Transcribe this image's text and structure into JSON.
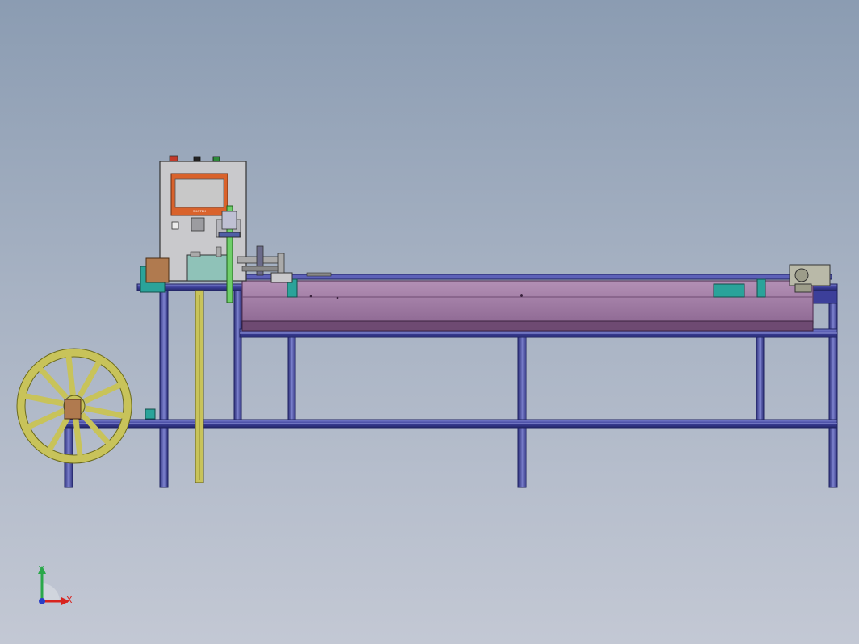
{
  "view": {
    "background_top": "#8b9cb2",
    "background_bottom": "#c3c8d4"
  },
  "machine": {
    "frame_color": "#3c3f9a",
    "frame_highlight": "#7d82cf",
    "bed_color": "#9e7aa4",
    "bed_edge": "#5b3a5e",
    "reel_color": "#c8c35a",
    "reel_edge": "#6b6a1c",
    "cabinet_color": "#c9c9cc",
    "screen_bezel": "#d9622b",
    "screen_color": "#c8c8c8",
    "bracket_color": "#2aa39a",
    "brown_block": "#b07a4f"
  },
  "control_panel": {
    "brand_label": "SKOTEK"
  },
  "triad": {
    "x_label": "X",
    "y_label": "Y",
    "x_color": "#d8241f",
    "y_color": "#2aa84a",
    "z_color": "#2a3ec8"
  }
}
